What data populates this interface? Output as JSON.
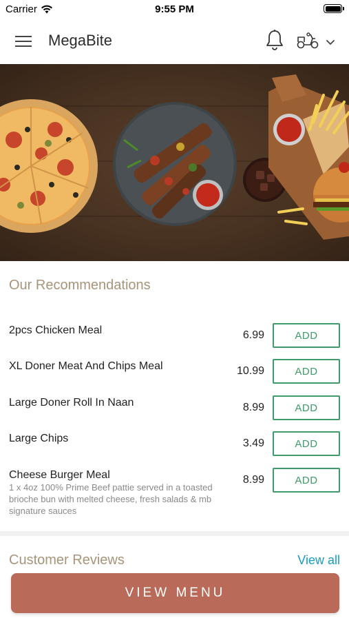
{
  "status_bar": {
    "carrier": "Carrier",
    "time": "9:55 PM"
  },
  "header": {
    "title": "MegaBite"
  },
  "recommendations": {
    "title": "Our Recommendations",
    "items": [
      {
        "name": "2pcs Chicken Meal",
        "price": "6.99",
        "button": "ADD",
        "description": ""
      },
      {
        "name": "XL Doner Meat And Chips Meal",
        "price": "10.99",
        "button": "ADD",
        "description": ""
      },
      {
        "name": "Large Doner Roll In Naan",
        "price": "8.99",
        "button": "ADD",
        "description": ""
      },
      {
        "name": "Large Chips",
        "price": "3.49",
        "button": "ADD",
        "description": ""
      },
      {
        "name": "Cheese Burger Meal",
        "price": "8.99",
        "button": "ADD",
        "description": "1 x 4oz 100% Prime Beef pattie served in a toasted brioche  bun with melted cheese, fresh salads & mb signature sauces"
      }
    ]
  },
  "reviews": {
    "title": "Customer Reviews",
    "view_all": "View all"
  },
  "footer": {
    "view_menu": "VIEW MENU"
  },
  "colors": {
    "accent_green": "#3e9a69",
    "section_title": "#a8947a",
    "link_blue": "#1a9bc7",
    "view_menu_bg": "#b96a59"
  },
  "icons": [
    "menu-icon",
    "bell-icon",
    "scooter-icon",
    "chevron-down-icon",
    "wifi-icon",
    "battery-icon"
  ]
}
